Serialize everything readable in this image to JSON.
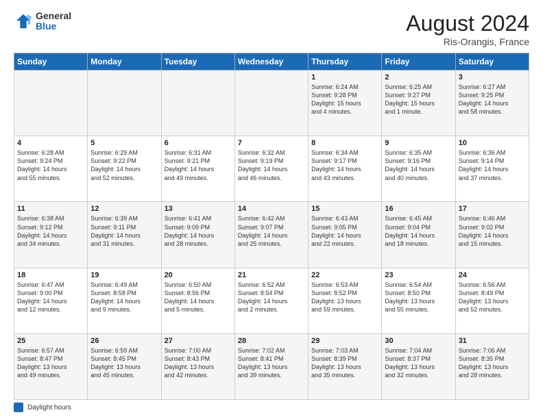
{
  "header": {
    "logo_general": "General",
    "logo_blue": "Blue",
    "month_year": "August 2024",
    "location": "Ris-Orangis, France"
  },
  "footer": {
    "label": "Daylight hours"
  },
  "weekdays": [
    "Sunday",
    "Monday",
    "Tuesday",
    "Wednesday",
    "Thursday",
    "Friday",
    "Saturday"
  ],
  "weeks": [
    [
      {
        "day": "",
        "info": ""
      },
      {
        "day": "",
        "info": ""
      },
      {
        "day": "",
        "info": ""
      },
      {
        "day": "",
        "info": ""
      },
      {
        "day": "1",
        "info": "Sunrise: 6:24 AM\nSunset: 9:28 PM\nDaylight: 15 hours\nand 4 minutes."
      },
      {
        "day": "2",
        "info": "Sunrise: 6:25 AM\nSunset: 9:27 PM\nDaylight: 15 hours\nand 1 minute."
      },
      {
        "day": "3",
        "info": "Sunrise: 6:27 AM\nSunset: 9:25 PM\nDaylight: 14 hours\nand 58 minutes."
      }
    ],
    [
      {
        "day": "4",
        "info": "Sunrise: 6:28 AM\nSunset: 9:24 PM\nDaylight: 14 hours\nand 55 minutes."
      },
      {
        "day": "5",
        "info": "Sunrise: 6:29 AM\nSunset: 9:22 PM\nDaylight: 14 hours\nand 52 minutes."
      },
      {
        "day": "6",
        "info": "Sunrise: 6:31 AM\nSunset: 9:21 PM\nDaylight: 14 hours\nand 49 minutes."
      },
      {
        "day": "7",
        "info": "Sunrise: 6:32 AM\nSunset: 9:19 PM\nDaylight: 14 hours\nand 46 minutes."
      },
      {
        "day": "8",
        "info": "Sunrise: 6:34 AM\nSunset: 9:17 PM\nDaylight: 14 hours\nand 43 minutes."
      },
      {
        "day": "9",
        "info": "Sunrise: 6:35 AM\nSunset: 9:16 PM\nDaylight: 14 hours\nand 40 minutes."
      },
      {
        "day": "10",
        "info": "Sunrise: 6:36 AM\nSunset: 9:14 PM\nDaylight: 14 hours\nand 37 minutes."
      }
    ],
    [
      {
        "day": "11",
        "info": "Sunrise: 6:38 AM\nSunset: 9:12 PM\nDaylight: 14 hours\nand 34 minutes."
      },
      {
        "day": "12",
        "info": "Sunrise: 6:39 AM\nSunset: 9:11 PM\nDaylight: 14 hours\nand 31 minutes."
      },
      {
        "day": "13",
        "info": "Sunrise: 6:41 AM\nSunset: 9:09 PM\nDaylight: 14 hours\nand 28 minutes."
      },
      {
        "day": "14",
        "info": "Sunrise: 6:42 AM\nSunset: 9:07 PM\nDaylight: 14 hours\nand 25 minutes."
      },
      {
        "day": "15",
        "info": "Sunrise: 6:43 AM\nSunset: 9:05 PM\nDaylight: 14 hours\nand 22 minutes."
      },
      {
        "day": "16",
        "info": "Sunrise: 6:45 AM\nSunset: 9:04 PM\nDaylight: 14 hours\nand 18 minutes."
      },
      {
        "day": "17",
        "info": "Sunrise: 6:46 AM\nSunset: 9:02 PM\nDaylight: 14 hours\nand 15 minutes."
      }
    ],
    [
      {
        "day": "18",
        "info": "Sunrise: 6:47 AM\nSunset: 9:00 PM\nDaylight: 14 hours\nand 12 minutes."
      },
      {
        "day": "19",
        "info": "Sunrise: 6:49 AM\nSunset: 8:58 PM\nDaylight: 14 hours\nand 9 minutes."
      },
      {
        "day": "20",
        "info": "Sunrise: 6:50 AM\nSunset: 8:56 PM\nDaylight: 14 hours\nand 5 minutes."
      },
      {
        "day": "21",
        "info": "Sunrise: 6:52 AM\nSunset: 8:54 PM\nDaylight: 14 hours\nand 2 minutes."
      },
      {
        "day": "22",
        "info": "Sunrise: 6:53 AM\nSunset: 8:52 PM\nDaylight: 13 hours\nand 59 minutes."
      },
      {
        "day": "23",
        "info": "Sunrise: 6:54 AM\nSunset: 8:50 PM\nDaylight: 13 hours\nand 55 minutes."
      },
      {
        "day": "24",
        "info": "Sunrise: 6:56 AM\nSunset: 8:49 PM\nDaylight: 13 hours\nand 52 minutes."
      }
    ],
    [
      {
        "day": "25",
        "info": "Sunrise: 6:57 AM\nSunset: 8:47 PM\nDaylight: 13 hours\nand 49 minutes."
      },
      {
        "day": "26",
        "info": "Sunrise: 6:59 AM\nSunset: 8:45 PM\nDaylight: 13 hours\nand 45 minutes."
      },
      {
        "day": "27",
        "info": "Sunrise: 7:00 AM\nSunset: 8:43 PM\nDaylight: 13 hours\nand 42 minutes."
      },
      {
        "day": "28",
        "info": "Sunrise: 7:02 AM\nSunset: 8:41 PM\nDaylight: 13 hours\nand 39 minutes."
      },
      {
        "day": "29",
        "info": "Sunrise: 7:03 AM\nSunset: 8:39 PM\nDaylight: 13 hours\nand 35 minutes."
      },
      {
        "day": "30",
        "info": "Sunrise: 7:04 AM\nSunset: 8:37 PM\nDaylight: 13 hours\nand 32 minutes."
      },
      {
        "day": "31",
        "info": "Sunrise: 7:06 AM\nSunset: 8:35 PM\nDaylight: 13 hours\nand 28 minutes."
      }
    ]
  ]
}
